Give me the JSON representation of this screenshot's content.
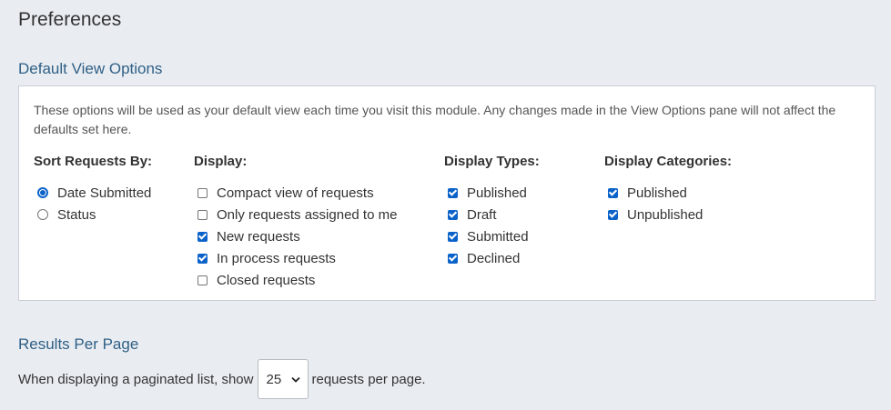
{
  "page_title": "Preferences",
  "default_view": {
    "heading": "Default View Options",
    "description": "These options will be used as your default view each time you visit this module. Any changes made in the View Options pane will not affect the defaults set here.",
    "sort": {
      "heading": "Sort Requests By:",
      "options": [
        {
          "label": "Date Submitted",
          "checked": true
        },
        {
          "label": "Status",
          "checked": false
        }
      ]
    },
    "display": {
      "heading": "Display:",
      "options": [
        {
          "label": "Compact view of requests",
          "checked": false
        },
        {
          "label": "Only requests assigned to me",
          "checked": false
        },
        {
          "label": "New requests",
          "checked": true
        },
        {
          "label": "In process requests",
          "checked": true
        },
        {
          "label": "Closed requests",
          "checked": false
        }
      ]
    },
    "display_types": {
      "heading": "Display Types:",
      "options": [
        {
          "label": "Published",
          "checked": true
        },
        {
          "label": "Draft",
          "checked": true
        },
        {
          "label": "Submitted",
          "checked": true
        },
        {
          "label": "Declined",
          "checked": true
        }
      ]
    },
    "display_categories": {
      "heading": "Display Categories:",
      "options": [
        {
          "label": "Published",
          "checked": true
        },
        {
          "label": "Unpublished",
          "checked": true
        }
      ]
    }
  },
  "results_per_page": {
    "heading": "Results Per Page",
    "prefix": "When displaying a paginated list, show",
    "value": "25",
    "suffix": "requests per page."
  },
  "colors": {
    "accent": "#0b63c9",
    "heading": "#2f5f85",
    "background": "#e9edf2"
  }
}
